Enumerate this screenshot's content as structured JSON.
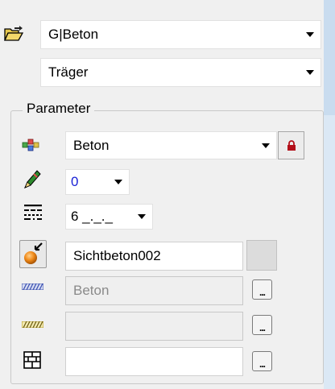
{
  "top": {
    "layer_combo": {
      "value": "G|Beton"
    },
    "type_combo": {
      "value": "Träger"
    }
  },
  "parameter": {
    "group_label": "Parameter",
    "material_combo": {
      "value": "Beton"
    },
    "pen_combo": {
      "value": "0",
      "color": "#1a22d6"
    },
    "line_combo": {
      "value": "6 _._._"
    },
    "surface_field": {
      "value": "Sichtbeton002"
    },
    "hatch_field": {
      "value": "Beton"
    },
    "pattern_field": {
      "value": ""
    },
    "fill_field": {
      "value": ""
    },
    "ellipsis_label": "..."
  },
  "colors": {
    "background": "#f0f0f0",
    "lock": "#b3101a",
    "hatch_blue": "#3a4fb0",
    "hatch_gold": "#b59a1c"
  }
}
